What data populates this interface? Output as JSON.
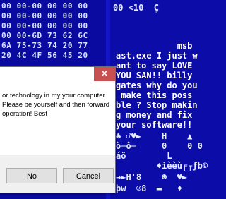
{
  "hex_dump": {
    "lines": [
      "00 00-00 00 00 00",
      "00 00-00 00 00 00",
      "00 00-00 00 00 00",
      "00 00-6D 73 62 6C",
      "6A 75-73 74 20 77",
      "20 4C 4F 56 45 20"
    ]
  },
  "text_dump": {
    "top_glyphs": "00 <10  Ç",
    "lines": [
      "            msb",
      "ast.exe I just w",
      "ant to say LOVE",
      "YOU SAN!! billy",
      "gates why do you",
      " make this poss",
      "ble ? Stop makin",
      "g money and fix",
      "your software!!"
    ],
    "garbage_lines": [
      "♣ ♂♥►    H    ▲",
      "ò═ô═     0    0 0",
      "áö        L",
      "        ♦ìèèù╒╓ƒb©",
      "→►H'8    ☻  ♥►",
      "þw  ☺8  ▬   ♦"
    ]
  },
  "dialog": {
    "close_glyph": "×",
    "message": "or technology in my your computer. Please be yourself and then forward operation!  Best",
    "buttons": {
      "no": "No",
      "cancel": "Cancel"
    }
  }
}
